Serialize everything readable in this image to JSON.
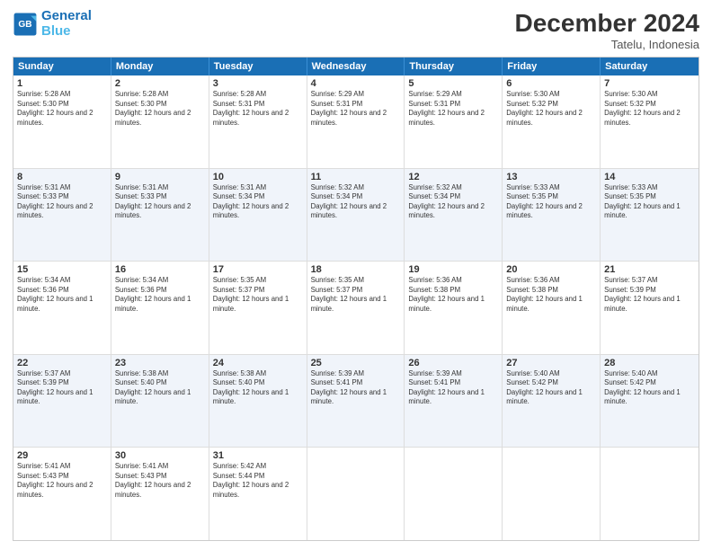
{
  "logo": {
    "line1": "General",
    "line2": "Blue"
  },
  "title": "December 2024",
  "subtitle": "Tatelu, Indonesia",
  "header_days": [
    "Sunday",
    "Monday",
    "Tuesday",
    "Wednesday",
    "Thursday",
    "Friday",
    "Saturday"
  ],
  "weeks": [
    [
      {
        "day": "1",
        "sunrise": "5:28 AM",
        "sunset": "5:30 PM",
        "daylight": "12 hours and 2 minutes."
      },
      {
        "day": "2",
        "sunrise": "5:28 AM",
        "sunset": "5:30 PM",
        "daylight": "12 hours and 2 minutes."
      },
      {
        "day": "3",
        "sunrise": "5:28 AM",
        "sunset": "5:31 PM",
        "daylight": "12 hours and 2 minutes."
      },
      {
        "day": "4",
        "sunrise": "5:29 AM",
        "sunset": "5:31 PM",
        "daylight": "12 hours and 2 minutes."
      },
      {
        "day": "5",
        "sunrise": "5:29 AM",
        "sunset": "5:31 PM",
        "daylight": "12 hours and 2 minutes."
      },
      {
        "day": "6",
        "sunrise": "5:30 AM",
        "sunset": "5:32 PM",
        "daylight": "12 hours and 2 minutes."
      },
      {
        "day": "7",
        "sunrise": "5:30 AM",
        "sunset": "5:32 PM",
        "daylight": "12 hours and 2 minutes."
      }
    ],
    [
      {
        "day": "8",
        "sunrise": "5:31 AM",
        "sunset": "5:33 PM",
        "daylight": "12 hours and 2 minutes."
      },
      {
        "day": "9",
        "sunrise": "5:31 AM",
        "sunset": "5:33 PM",
        "daylight": "12 hours and 2 minutes."
      },
      {
        "day": "10",
        "sunrise": "5:31 AM",
        "sunset": "5:34 PM",
        "daylight": "12 hours and 2 minutes."
      },
      {
        "day": "11",
        "sunrise": "5:32 AM",
        "sunset": "5:34 PM",
        "daylight": "12 hours and 2 minutes."
      },
      {
        "day": "12",
        "sunrise": "5:32 AM",
        "sunset": "5:34 PM",
        "daylight": "12 hours and 2 minutes."
      },
      {
        "day": "13",
        "sunrise": "5:33 AM",
        "sunset": "5:35 PM",
        "daylight": "12 hours and 2 minutes."
      },
      {
        "day": "14",
        "sunrise": "5:33 AM",
        "sunset": "5:35 PM",
        "daylight": "12 hours and 1 minute."
      }
    ],
    [
      {
        "day": "15",
        "sunrise": "5:34 AM",
        "sunset": "5:36 PM",
        "daylight": "12 hours and 1 minute."
      },
      {
        "day": "16",
        "sunrise": "5:34 AM",
        "sunset": "5:36 PM",
        "daylight": "12 hours and 1 minute."
      },
      {
        "day": "17",
        "sunrise": "5:35 AM",
        "sunset": "5:37 PM",
        "daylight": "12 hours and 1 minute."
      },
      {
        "day": "18",
        "sunrise": "5:35 AM",
        "sunset": "5:37 PM",
        "daylight": "12 hours and 1 minute."
      },
      {
        "day": "19",
        "sunrise": "5:36 AM",
        "sunset": "5:38 PM",
        "daylight": "12 hours and 1 minute."
      },
      {
        "day": "20",
        "sunrise": "5:36 AM",
        "sunset": "5:38 PM",
        "daylight": "12 hours and 1 minute."
      },
      {
        "day": "21",
        "sunrise": "5:37 AM",
        "sunset": "5:39 PM",
        "daylight": "12 hours and 1 minute."
      }
    ],
    [
      {
        "day": "22",
        "sunrise": "5:37 AM",
        "sunset": "5:39 PM",
        "daylight": "12 hours and 1 minute."
      },
      {
        "day": "23",
        "sunrise": "5:38 AM",
        "sunset": "5:40 PM",
        "daylight": "12 hours and 1 minute."
      },
      {
        "day": "24",
        "sunrise": "5:38 AM",
        "sunset": "5:40 PM",
        "daylight": "12 hours and 1 minute."
      },
      {
        "day": "25",
        "sunrise": "5:39 AM",
        "sunset": "5:41 PM",
        "daylight": "12 hours and 1 minute."
      },
      {
        "day": "26",
        "sunrise": "5:39 AM",
        "sunset": "5:41 PM",
        "daylight": "12 hours and 1 minute."
      },
      {
        "day": "27",
        "sunrise": "5:40 AM",
        "sunset": "5:42 PM",
        "daylight": "12 hours and 1 minute."
      },
      {
        "day": "28",
        "sunrise": "5:40 AM",
        "sunset": "5:42 PM",
        "daylight": "12 hours and 1 minute."
      }
    ],
    [
      {
        "day": "29",
        "sunrise": "5:41 AM",
        "sunset": "5:43 PM",
        "daylight": "12 hours and 2 minutes."
      },
      {
        "day": "30",
        "sunrise": "5:41 AM",
        "sunset": "5:43 PM",
        "daylight": "12 hours and 2 minutes."
      },
      {
        "day": "31",
        "sunrise": "5:42 AM",
        "sunset": "5:44 PM",
        "daylight": "12 hours and 2 minutes."
      },
      null,
      null,
      null,
      null
    ]
  ],
  "labels": {
    "sunrise": "Sunrise:",
    "sunset": "Sunset:",
    "daylight": "Daylight:"
  }
}
